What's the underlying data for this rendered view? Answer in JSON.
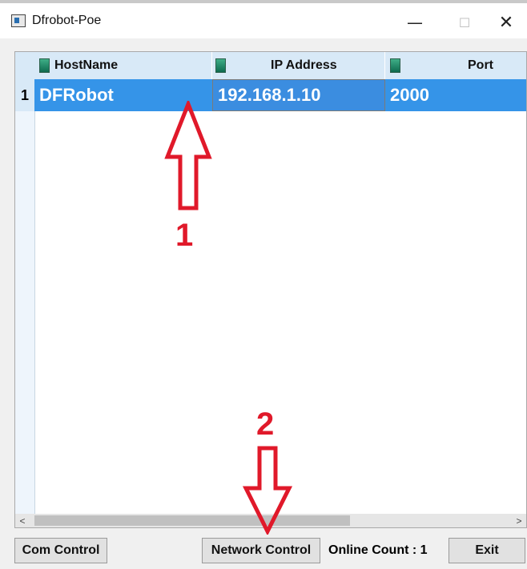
{
  "window": {
    "title": "Dfrobot-Poe",
    "controls": {
      "minimize": "—",
      "maximize": "☐",
      "close": "✕"
    }
  },
  "table": {
    "columns": [
      {
        "label": "HostName",
        "icon": "column-db-icon"
      },
      {
        "label": "IP Address",
        "icon": "column-db-icon"
      },
      {
        "label": "Port",
        "icon": "column-db-icon"
      }
    ],
    "rows": [
      {
        "index": "1",
        "hostname": "DFRobot",
        "ip": "192.168.1.10",
        "port": "2000"
      }
    ],
    "selection_color": "#3594e8",
    "header_color": "#d8e9f7"
  },
  "scrollbar": {
    "left_arrow": "<",
    "right_arrow": ">"
  },
  "footer": {
    "com_control": "Com Control",
    "network_control": "Network Control",
    "online_count": "Online Count : 1",
    "exit": "Exit"
  },
  "annotations": {
    "arrow1_label": "1",
    "arrow2_label": "2",
    "color": "#e0192a"
  }
}
